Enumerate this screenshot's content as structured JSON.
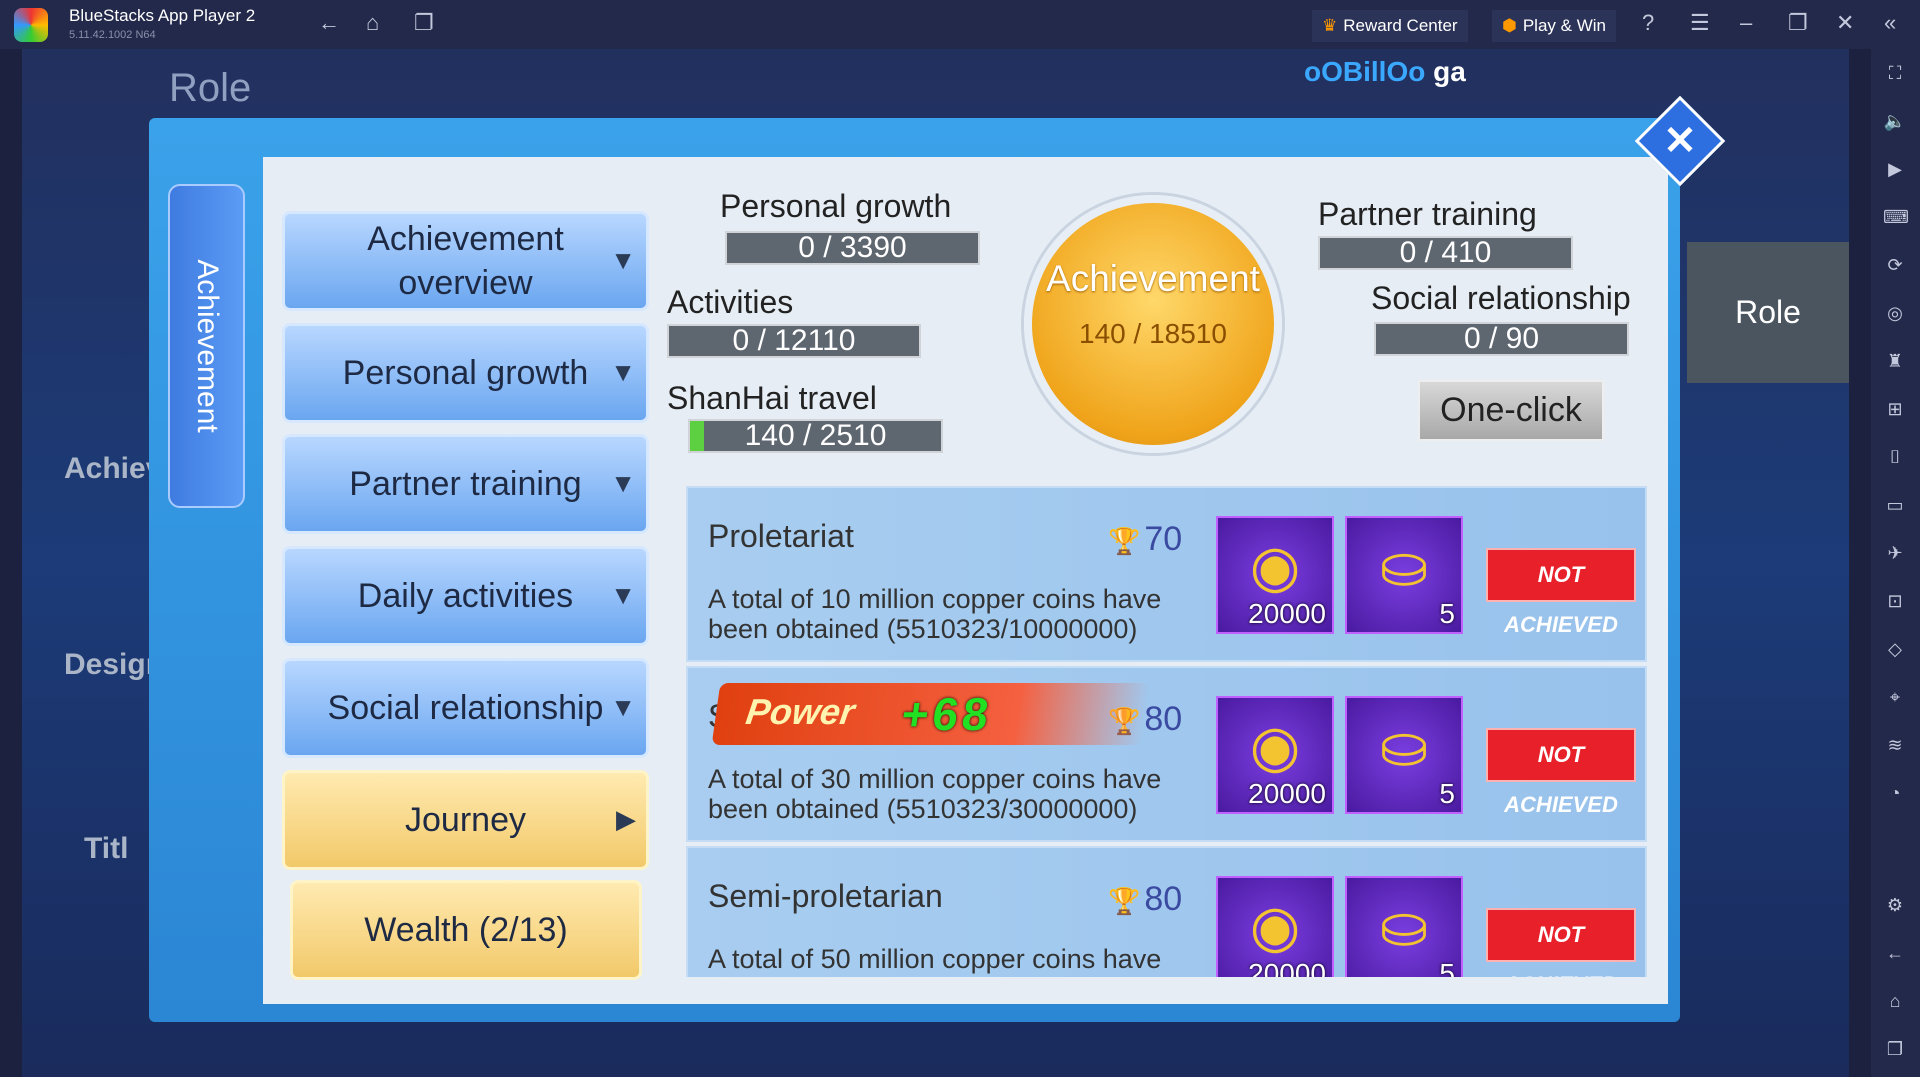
{
  "window": {
    "title": "BlueStacks App Player 2",
    "version": "5.11.42.1002  N64",
    "reward_center": "Reward Center",
    "play_win": "Play & Win"
  },
  "game": {
    "header": "Role",
    "player_name": "oOBillOo",
    "player_suffix": "ga",
    "right_tab": "Role",
    "left_side": [
      "Achieven",
      "Designa",
      "Titl"
    ],
    "vertical_tab": "Achievement",
    "menu": [
      {
        "label": "Achievement overview",
        "icon": "triangle-down"
      },
      {
        "label": "Personal growth",
        "icon": "triangle-down"
      },
      {
        "label": "Partner training",
        "icon": "triangle-down"
      },
      {
        "label": "Daily activities",
        "icon": "triangle-down"
      },
      {
        "label": "Social relationship",
        "icon": "triangle-down"
      },
      {
        "label": "Journey",
        "icon": "triangle-right"
      },
      {
        "label": "Wealth (2/13)"
      }
    ],
    "stats": {
      "personal_growth": {
        "label": "Personal growth",
        "value": "0 / 3390"
      },
      "activities": {
        "label": "Activities",
        "value": "0 / 12110"
      },
      "shanhai": {
        "label": "ShanHai travel",
        "value": "140 / 2510",
        "progress": 0.056
      },
      "partner": {
        "label": "Partner training",
        "value": "0 / 410"
      },
      "social": {
        "label": "Social relationship",
        "value": "0 / 90"
      },
      "achievement": {
        "label": "Achievement",
        "value": "140 / 18510"
      }
    },
    "one_click": "One-click",
    "power": {
      "label": "Power",
      "value": "+68"
    },
    "achievements": [
      {
        "name": "Proletariat",
        "points": "70",
        "desc": "A total of 10 million copper coins have been obtained (5510323/10000000)",
        "reward1": "20000",
        "reward2": "5",
        "status": "NOT ACHIEVED"
      },
      {
        "name": "S",
        "points": "80",
        "desc": "A total of 30 million copper coins have been obtained (5510323/30000000)",
        "reward1": "20000",
        "reward2": "5",
        "status": "NOT ACHIEVED"
      },
      {
        "name": "Semi-proletarian",
        "points": "80",
        "desc": "A total of 50 million copper coins have",
        "reward1": "20000",
        "reward2": "5",
        "status": "NOT ACHIEVED"
      }
    ]
  }
}
